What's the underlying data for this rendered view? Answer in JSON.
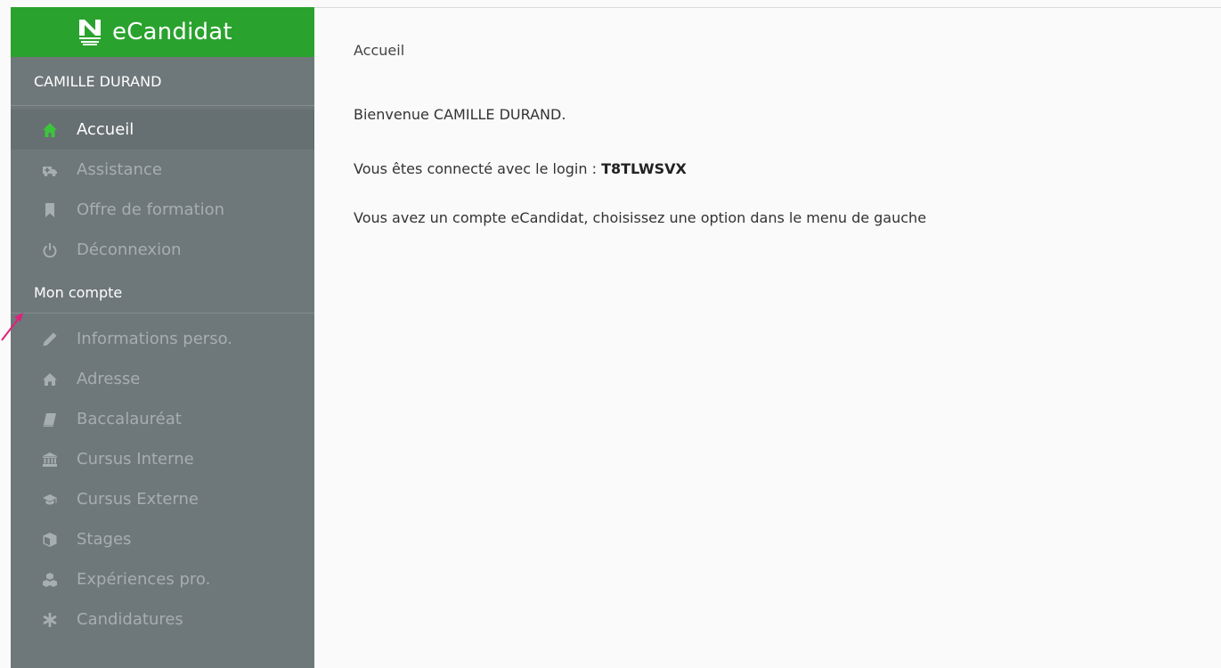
{
  "app": {
    "name": "eCandidat",
    "brand_color": "#2aa22e"
  },
  "sidebar": {
    "user_name": "CAMILLE DURAND",
    "items": [
      {
        "label": "Accueil",
        "icon": "home-icon",
        "active": true
      },
      {
        "label": "Assistance",
        "icon": "ambulance-icon"
      },
      {
        "label": "Offre de formation",
        "icon": "bookmark-icon"
      },
      {
        "label": "Déconnexion",
        "icon": "power-icon"
      }
    ],
    "section_title": "Mon compte",
    "account_items": [
      {
        "label": "Informations perso.",
        "icon": "pencil-icon"
      },
      {
        "label": "Adresse",
        "icon": "house-icon"
      },
      {
        "label": "Baccalauréat",
        "icon": "book-icon"
      },
      {
        "label": "Cursus Interne",
        "icon": "institution-icon"
      },
      {
        "label": "Cursus Externe",
        "icon": "graduation-cap-icon"
      },
      {
        "label": "Stages",
        "icon": "cube-icon"
      },
      {
        "label": "Expériences pro.",
        "icon": "cubes-icon"
      },
      {
        "label": "Candidatures",
        "icon": "asterisk-icon"
      }
    ]
  },
  "main": {
    "breadcrumb": "Accueil",
    "welcome": "Bienvenue CAMILLE DURAND.",
    "login_prefix": "Vous êtes connecté avec le login : ",
    "login_value": "T8TLWSVX",
    "instruction": "Vous avez un compte eCandidat, choisissez une option dans le menu de gauche"
  }
}
